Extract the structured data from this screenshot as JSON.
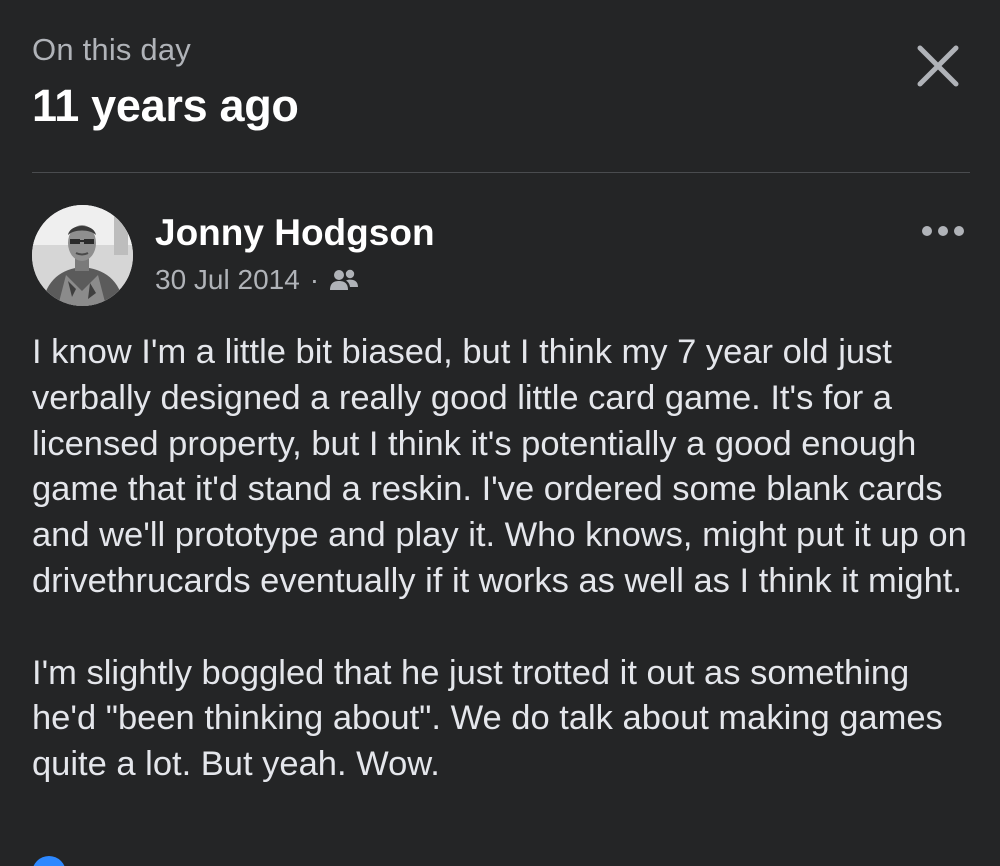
{
  "header": {
    "kicker": "On this day",
    "title": "11 years ago",
    "close_icon": "close-icon"
  },
  "post": {
    "author": "Jonny Hodgson",
    "date": "30 Jul 2014",
    "separator": "·",
    "audience_icon": "friends-icon",
    "more_icon": "more-options-icon",
    "paragraphs": [
      "I know I'm a little bit biased, but I think my 7 year old just verbally designed a really good little card game. It's for a licensed property, but I think it's potentially a good enough game that it'd stand a reskin. I've ordered some blank cards and we'll prototype and play it. Who knows, might put it up on drivethrucards eventually if it works as well as I think it might.",
      "I'm slightly boggled that he just trotted it out as something he'd \"been thinking about\".  We do talk about making games quite a lot. But yeah. Wow."
    ]
  },
  "colors": {
    "background": "#242526",
    "primary_text": "#e4e6eb",
    "secondary_text": "#b0b3b8",
    "reaction_blue": "#2d88ff"
  }
}
